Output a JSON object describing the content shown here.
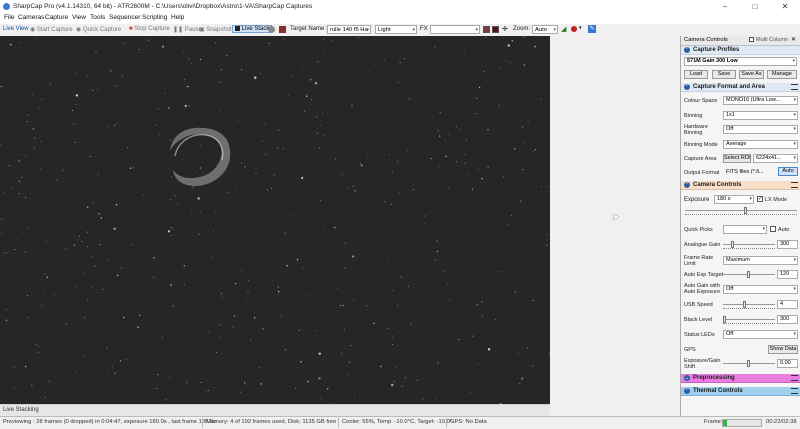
{
  "window": {
    "title": "SharpCap Pro (v4.1.14310, 64 bit) - ATR2600M - C:\\Users\\olivi\\Dropbox\\Astro\\1-VA\\SharpCap Captures",
    "minimize_icon": "minimize-icon",
    "maximize_icon": "maximize-icon",
    "close_icon": "close-icon"
  },
  "menu": {
    "items": [
      "File",
      "Cameras",
      "Capture",
      "View",
      "Tools",
      "Sequencer",
      "Scripting",
      "Help"
    ]
  },
  "toolbar": {
    "live_view": "Live View",
    "start_capture": "Start Capture",
    "quick_capture": "Quick Capture",
    "stop_capture": "Stop Capture",
    "pause": "Pause",
    "snapshot": "Snapshot",
    "live_stack": "Live Stack",
    "target_name_label": "Target Name :",
    "target_name_value": "rulle 140 f5 Ha",
    "frame_type_value": "Light",
    "fx_label": "FX",
    "fx_value": "",
    "zoom_label": "Zoom:",
    "zoom_value": "Auto"
  },
  "bottom_tab": "Live Stacking",
  "statusbar": {
    "previewing": "Previewing : 28 frames (0 dropped) in 0:04:47, exposure 180.0s , last frame 180.0s",
    "memory": "Memory: 4 of 192 frames used, Disk: 1135 GB free",
    "cooler": "Cooler: 55%, Temp: -10.0°C, Target: -10.0°",
    "gps": "GPS: No Data",
    "frame_label": "Frame:",
    "frame_progress": 0.1,
    "elapsed": "00:22/02:38"
  },
  "panel": {
    "title": "Camera Controls",
    "multi_column_label": "Multi Column",
    "capture_profiles": {
      "header": "Capture Profiles",
      "selected": "571M Gain 300 Low",
      "buttons": [
        "Load",
        "Save",
        "Save As",
        "Manage"
      ]
    },
    "capture_format": {
      "header": "Capture Format and Area",
      "colour_space_label": "Colour Space",
      "colour_space_value": "MONO16 (Ultra Low...",
      "binning_label": "Binning",
      "binning_value": "1x1",
      "hardware_binning_label": "Hardware Binning",
      "hardware_binning_value": "Off",
      "binning_mode_label": "Binning Mode",
      "binning_mode_value": "Average",
      "capture_area_label": "Capture Area",
      "select_roi_button": "Select ROI",
      "capture_area_value": "6224x41...",
      "output_format_label": "Output Format",
      "output_format_value": "FITS files (*.fi...",
      "auto_button": "Auto"
    },
    "camera_controls": {
      "header": "Camera Controls",
      "exposure_label": "Exposure",
      "exposure_value": "180 s",
      "lx_mode_label": "LX Mode",
      "lx_mode_checked": "✓",
      "quick_picks_label": "Quick Picks",
      "quick_picks_value": "",
      "quick_picks_auto_label": "Auto",
      "analogue_gain_label": "Analogue Gain",
      "analogue_gain_value": "300",
      "frame_rate_label": "Frame Rate Limit",
      "frame_rate_value": "Maximum",
      "auto_exp_target_label": "Auto Exp Target",
      "auto_exp_target_value": "120",
      "auto_gain_label": "Auto Gain with Auto Exposure",
      "auto_gain_value": "Off",
      "usb_speed_label": "USB Speed",
      "usb_speed_value": "4",
      "black_level_label": "Black Level",
      "black_level_value": "300",
      "status_leds_label": "Status LEDs",
      "status_leds_value": "Off",
      "gps_label": "GPS",
      "show_data_button": "Show Data",
      "exposure_gain_shift_label": "Exposure/Gain Shift",
      "exposure_gain_shift_value": "0.00"
    },
    "preprocessing": {
      "header": "Preprocessing",
      "color": "#e97ee0"
    },
    "thermal_controls": {
      "header": "Thermal Controls",
      "color": "#9fd0ee"
    }
  },
  "colors": {
    "sky_background": "#262626",
    "camera_controls_header": "#f9dfc8",
    "panel_header": "#dfe9f5",
    "frame_progress": "#2fb84a"
  }
}
